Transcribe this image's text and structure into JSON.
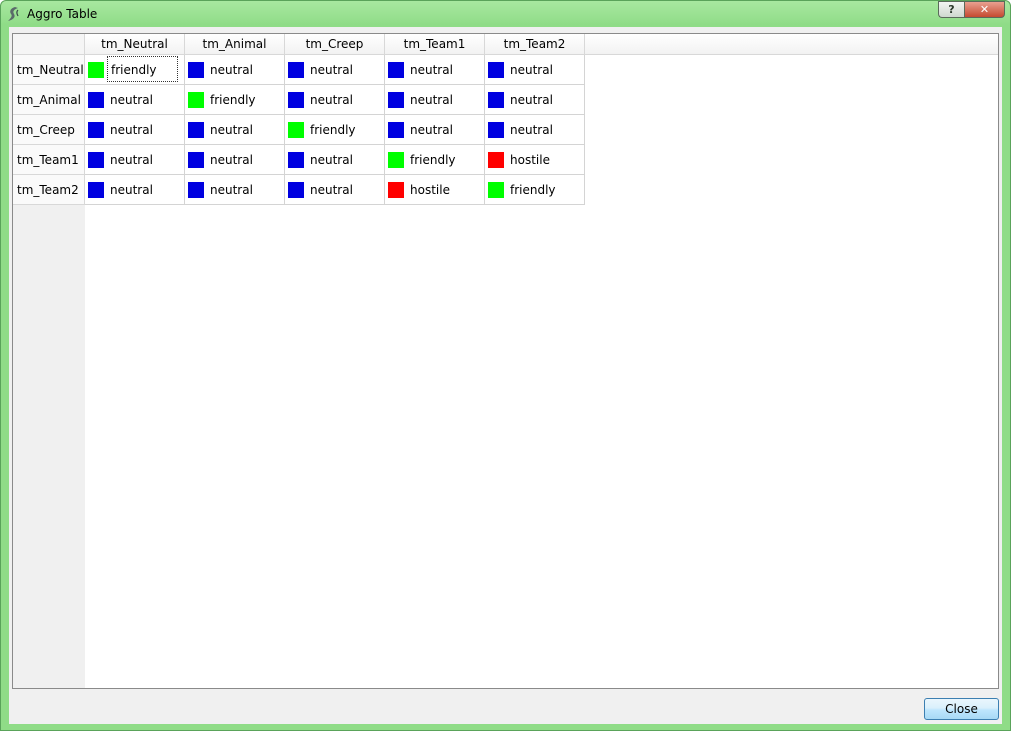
{
  "window": {
    "title": "Aggro Table",
    "help_label": "?",
    "close_label": "✕"
  },
  "table": {
    "columns": [
      "tm_Neutral",
      "tm_Animal",
      "tm_Creep",
      "tm_Team1",
      "tm_Team2"
    ],
    "rows": [
      {
        "label": "tm_Neutral",
        "cells": [
          "friendly",
          "neutral",
          "neutral",
          "neutral",
          "neutral"
        ]
      },
      {
        "label": "tm_Animal",
        "cells": [
          "neutral",
          "friendly",
          "neutral",
          "neutral",
          "neutral"
        ]
      },
      {
        "label": "tm_Creep",
        "cells": [
          "neutral",
          "neutral",
          "friendly",
          "neutral",
          "neutral"
        ]
      },
      {
        "label": "tm_Team1",
        "cells": [
          "neutral",
          "neutral",
          "neutral",
          "friendly",
          "hostile"
        ]
      },
      {
        "label": "tm_Team2",
        "cells": [
          "neutral",
          "neutral",
          "neutral",
          "hostile",
          "friendly"
        ]
      }
    ],
    "focused_cell": [
      0,
      0
    ]
  },
  "status_colors": {
    "friendly": "#00ff00",
    "neutral": "#0000e0",
    "hostile": "#ff0000"
  },
  "footer": {
    "close_label": "Close"
  }
}
